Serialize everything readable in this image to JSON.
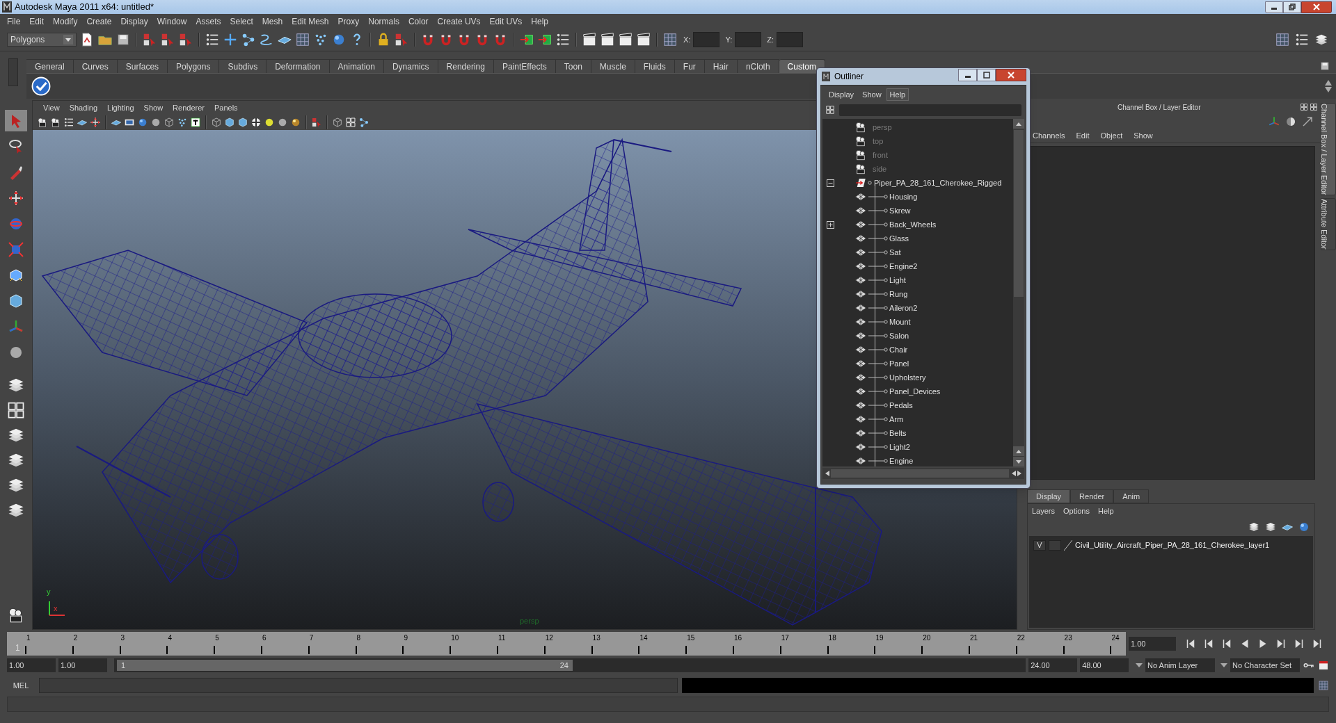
{
  "window": {
    "title": "Autodesk Maya 2011 x64: untitled*"
  },
  "menu_bar": [
    "File",
    "Edit",
    "Modify",
    "Create",
    "Display",
    "Window",
    "Assets",
    "Select",
    "Mesh",
    "Edit Mesh",
    "Proxy",
    "Normals",
    "Color",
    "Create UVs",
    "Edit UVs",
    "Help"
  ],
  "toolbar": {
    "mode": "Polygons",
    "coords": [
      "X:",
      "Y:",
      "Z:"
    ]
  },
  "shelf_tabs": [
    {
      "label": "General",
      "selected": false
    },
    {
      "label": "Curves",
      "selected": false
    },
    {
      "label": "Surfaces",
      "selected": false
    },
    {
      "label": "Polygons",
      "selected": false
    },
    {
      "label": "Subdivs",
      "selected": false
    },
    {
      "label": "Deformation",
      "selected": false
    },
    {
      "label": "Animation",
      "selected": false
    },
    {
      "label": "Dynamics",
      "selected": false
    },
    {
      "label": "Rendering",
      "selected": false
    },
    {
      "label": "PaintEffects",
      "selected": false
    },
    {
      "label": "Toon",
      "selected": false
    },
    {
      "label": "Muscle",
      "selected": false
    },
    {
      "label": "Fluids",
      "selected": false
    },
    {
      "label": "Fur",
      "selected": false
    },
    {
      "label": "Hair",
      "selected": false
    },
    {
      "label": "nCloth",
      "selected": false
    },
    {
      "label": "Custom",
      "selected": true
    }
  ],
  "viewport": {
    "menu": [
      "View",
      "Shading",
      "Lighting",
      "Show",
      "Renderer",
      "Panels"
    ],
    "camera": "persp",
    "axes": [
      "y",
      "x"
    ]
  },
  "outliner": {
    "title": "Outliner",
    "menu": [
      {
        "label": "Display",
        "selected": false
      },
      {
        "label": "Show",
        "selected": false
      },
      {
        "label": "Help",
        "selected": true
      }
    ],
    "items": [
      {
        "name": "persp",
        "kind": "camera"
      },
      {
        "name": "top",
        "kind": "camera"
      },
      {
        "name": "front",
        "kind": "camera"
      },
      {
        "name": "side",
        "kind": "camera"
      },
      {
        "name": "Piper_PA_28_161_Cherokee_Rigged",
        "kind": "transform",
        "expanded": true,
        "children": [
          {
            "name": "Housing",
            "kind": "mesh"
          },
          {
            "name": "Skrew",
            "kind": "mesh"
          },
          {
            "name": "Back_Wheels",
            "kind": "mesh",
            "expanded": false
          },
          {
            "name": "Glass",
            "kind": "mesh"
          },
          {
            "name": "Sat",
            "kind": "mesh"
          },
          {
            "name": "Engine2",
            "kind": "mesh"
          },
          {
            "name": "Light",
            "kind": "mesh"
          },
          {
            "name": "Rung",
            "kind": "mesh"
          },
          {
            "name": "Aileron2",
            "kind": "mesh"
          },
          {
            "name": "Mount",
            "kind": "mesh"
          },
          {
            "name": "Salon",
            "kind": "mesh"
          },
          {
            "name": "Chair",
            "kind": "mesh"
          },
          {
            "name": "Panel",
            "kind": "mesh"
          },
          {
            "name": "Upholstery",
            "kind": "mesh"
          },
          {
            "name": "Panel_Devices",
            "kind": "mesh"
          },
          {
            "name": "Pedals",
            "kind": "mesh"
          },
          {
            "name": "Arm",
            "kind": "mesh"
          },
          {
            "name": "Belts",
            "kind": "mesh"
          },
          {
            "name": "Light2",
            "kind": "mesh"
          },
          {
            "name": "Engine",
            "kind": "mesh"
          }
        ]
      }
    ]
  },
  "channel_box": {
    "title": "Channel Box / Layer Editor",
    "menu": [
      "Channels",
      "Edit",
      "Object",
      "Show"
    ]
  },
  "layer_editor": {
    "tabs": [
      {
        "label": "Display",
        "selected": true
      },
      {
        "label": "Render",
        "selected": false
      },
      {
        "label": "Anim",
        "selected": false
      }
    ],
    "menu": [
      "Layers",
      "Options",
      "Help"
    ],
    "layers": [
      {
        "visibility": "V",
        "name": "Civil_Utility_Aircraft_Piper_PA_28_161_Cherokee_layer1"
      }
    ]
  },
  "side_tabs": [
    {
      "label": "Channel Box / Layer Editor",
      "selected": true
    },
    {
      "label": "Attribute Editor",
      "selected": false
    }
  ],
  "timeline": {
    "ticks": [
      "1",
      "2",
      "3",
      "4",
      "5",
      "6",
      "7",
      "8",
      "9",
      "10",
      "11",
      "12",
      "13",
      "14",
      "15",
      "16",
      "17",
      "18",
      "19",
      "20",
      "21",
      "22",
      "23",
      "24"
    ],
    "current_frame": "1",
    "level": 0,
    "current_time": "1.00"
  },
  "range": {
    "start": "1.00",
    "playback_start": "1.00",
    "slider_start": "1",
    "slider_end": "24",
    "playback_end": "24.00",
    "end": "48.00",
    "anim_layer": "No Anim Layer",
    "character_set": "No Character Set"
  },
  "command_line": {
    "language": "MEL"
  }
}
